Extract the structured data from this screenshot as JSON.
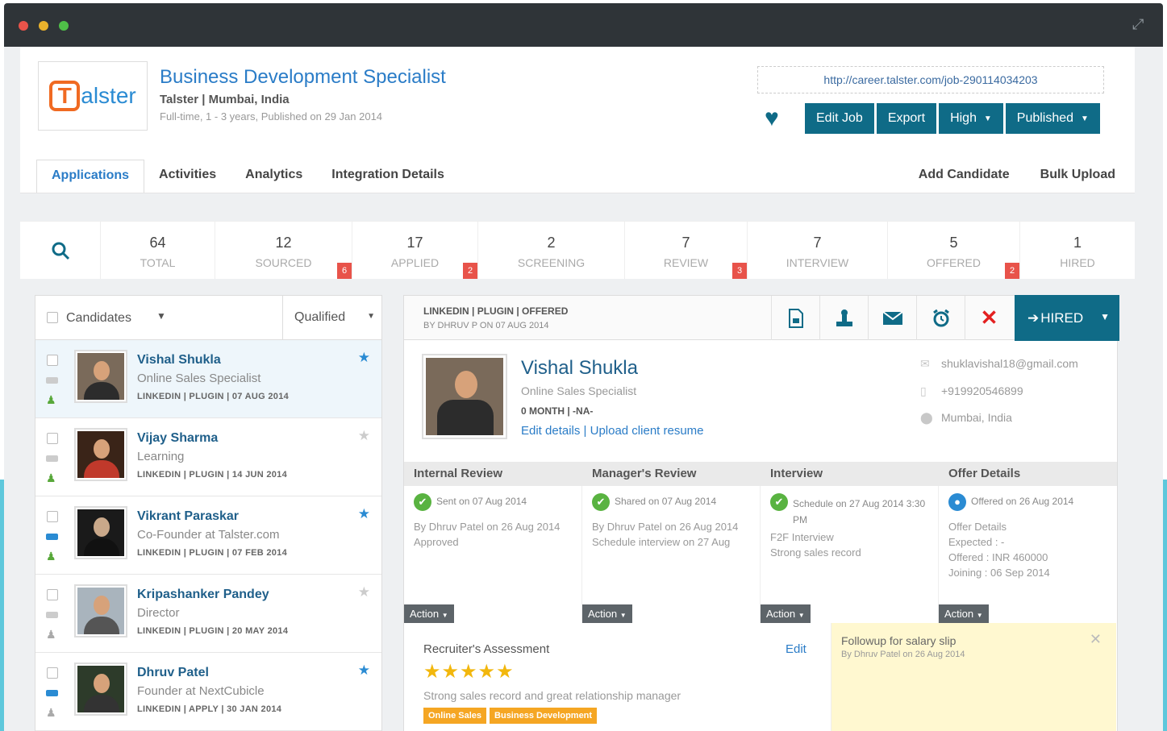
{
  "job": {
    "title": "Business Development Specialist",
    "company": "Talster | Mumbai, India",
    "meta": "Full-time,  1 - 3 years,  Published on 29 Jan 2014",
    "url": "http://career.talster.com/job-290114034203",
    "logo_t": "T",
    "logo_rest": "alster"
  },
  "buttons": {
    "edit": "Edit Job",
    "export": "Export",
    "priority": "High",
    "status": "Published"
  },
  "tabs": [
    "Applications",
    "Activities",
    "Analytics",
    "Integration Details"
  ],
  "tabs_right": [
    "Add Candidate",
    "Bulk Upload"
  ],
  "stats": [
    {
      "num": "64",
      "label": "TOTAL",
      "badge": ""
    },
    {
      "num": "12",
      "label": "SOURCED",
      "badge": "6"
    },
    {
      "num": "17",
      "label": "APPLIED",
      "badge": "2"
    },
    {
      "num": "2",
      "label": "SCREENING",
      "badge": ""
    },
    {
      "num": "7",
      "label": "REVIEW",
      "badge": "3"
    },
    {
      "num": "7",
      "label": "INTERVIEW",
      "badge": ""
    },
    {
      "num": "5",
      "label": "OFFERED",
      "badge": "2"
    },
    {
      "num": "1",
      "label": "HIRED",
      "badge": ""
    }
  ],
  "list": {
    "filter_label": "Candidates",
    "qualified_label": "Qualified",
    "candidates": [
      {
        "name": "Vishal Shukla",
        "title": "Online Sales Specialist",
        "meta": "LINKEDIN | PLUGIN | 07 AUG 2014"
      },
      {
        "name": "Vijay Sharma",
        "title": "Learning",
        "meta": "LINKEDIN | PLUGIN | 14 JUN 2014"
      },
      {
        "name": "Vikrant Paraskar",
        "title": "Co-Founder at Talster.com",
        "meta": "LINKEDIN | PLUGIN | 07 FEB 2014"
      },
      {
        "name": "Kripashanker Pandey",
        "title": "Director",
        "meta": "LINKEDIN | PLUGIN | 20 MAY 2014"
      },
      {
        "name": "Dhruv Patel",
        "title": "Founder at NextCubicle",
        "meta": "LINKEDIN | APPLY | 30 JAN 2014"
      }
    ]
  },
  "detail": {
    "source": "LINKEDIN | PLUGIN | OFFERED",
    "by": "BY DHRUV P ON 07 AUG 2014",
    "hired_label": "HIRED",
    "name": "Vishal Shukla",
    "title": "Online Sales Specialist",
    "exp": "0 MONTH | -NA-",
    "links": "Edit details | Upload client resume",
    "email": "shuklavishal18@gmail.com",
    "phone": "+919920546899",
    "location": "Mumbai, India"
  },
  "columns": [
    {
      "head": "Internal Review",
      "status": "Sent on 07 Aug 2014",
      "lines": [
        "By Dhruv Patel on 26 Aug 2014",
        "Approved"
      ]
    },
    {
      "head": "Manager's Review",
      "status": "Shared on 07 Aug 2014",
      "lines": [
        "By Dhruv Patel on 26 Aug 2014",
        "Schedule interview on 27 Aug"
      ]
    },
    {
      "head": "Interview",
      "status": "Schedule on 27 Aug 2014 3:30 PM",
      "lines": [
        "F2F Interview",
        "Strong sales record"
      ]
    },
    {
      "head": "Offer Details",
      "status": "Offered on 26 Aug 2014",
      "lines": [
        "Offer Details",
        "Expected : -",
        "Offered : INR 460000",
        "Joining : 06 Sep 2014"
      ]
    }
  ],
  "action_label": "Action",
  "assessment": {
    "title": "Recruiter's Assessment",
    "edit": "Edit",
    "stars": 5,
    "text": "Strong sales record and great relationship manager",
    "tags": [
      "Online Sales",
      "Business Development"
    ]
  },
  "followup": {
    "title": "Followup for salary slip",
    "by": "By Dhruv Patel on 26 Aug 2014"
  }
}
